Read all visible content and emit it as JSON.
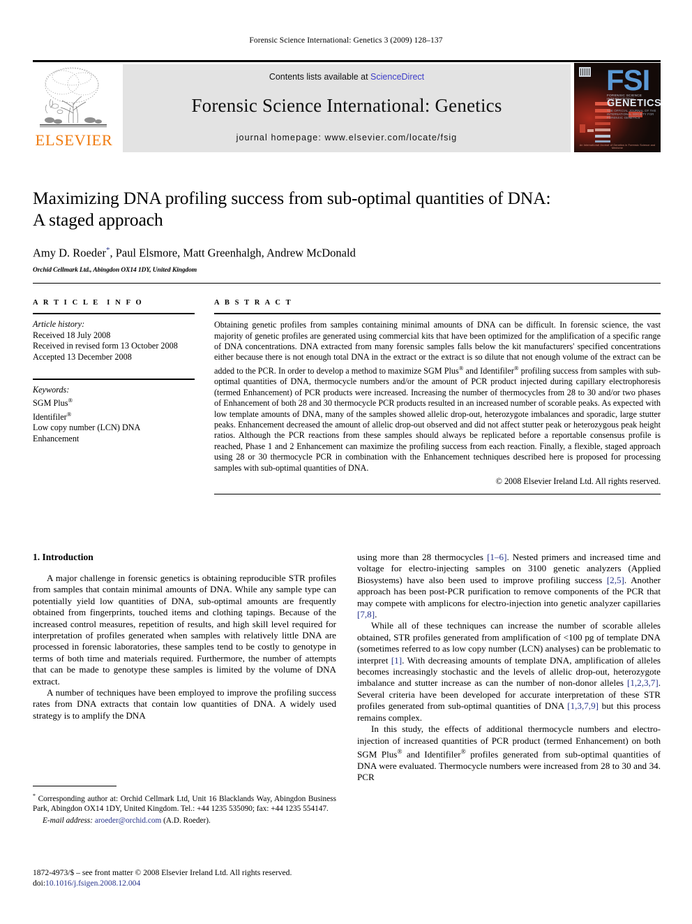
{
  "running_head": "Forensic Science International: Genetics 3 (2009) 128–137",
  "masthead": {
    "publisher_name": "ELSEVIER",
    "contents_prefix": "Contents lists available at ",
    "contents_link": "ScienceDirect",
    "journal_title": "Forensic Science International: Genetics",
    "homepage": "journal homepage: www.elsevier.com/locate/fsig",
    "cover": {
      "logo_text": "FSI",
      "logo_subtitle": "FORENSIC SCIENCE INTERNATIONAL",
      "section": "GENETICS",
      "section_subtitle": "THE OFFICIAL JOURNAL OF THE INTERNATIONAL SOCIETY FOR FORENSIC GENETICS",
      "footer": "An International Journal of Genetics in Forensic Science and Medicine"
    }
  },
  "article": {
    "title_line1": "Maximizing DNA profiling success from sub-optimal quantities of DNA:",
    "title_line2": "A staged approach",
    "authors": "Amy D. Roeder",
    "authors_rest": ", Paul Elsmore, Matt Greenhalgh, Andrew McDonald",
    "corresponding_marker": "*",
    "affiliation": "Orchid Cellmark Ltd., Abingdon OX14 1DY, United Kingdom"
  },
  "article_info": {
    "heading": "ARTICLE INFO",
    "history_label": "Article history:",
    "history": [
      "Received 18 July 2008",
      "Received in revised form 13 October 2008",
      "Accepted 13 December 2008"
    ],
    "keywords_label": "Keywords:",
    "keywords": [
      "SGM Plus®",
      "Identifiler®",
      "Low copy number (LCN) DNA",
      "Enhancement"
    ]
  },
  "abstract": {
    "heading": "ABSTRACT",
    "text": "Obtaining genetic profiles from samples containing minimal amounts of DNA can be difficult. In forensic science, the vast majority of genetic profiles are generated using commercial kits that have been optimized for the amplification of a specific range of DNA concentrations. DNA extracted from many forensic samples falls below the kit manufacturers' specified concentrations either because there is not enough total DNA in the extract or the extract is so dilute that not enough volume of the extract can be added to the PCR. In order to develop a method to maximize SGM Plus® and Identifiler® profiling success from samples with sub-optimal quantities of DNA, thermocycle numbers and/or the amount of PCR product injected during capillary electrophoresis (termed Enhancement) of PCR products were increased. Increasing the number of thermocycles from 28 to 30 and/or two phases of Enhancement of both 28 and 30 thermocycle PCR products resulted in an increased number of scorable peaks. As expected with low template amounts of DNA, many of the samples showed allelic drop-out, heterozygote imbalances and sporadic, large stutter peaks. Enhancement decreased the amount of allelic drop-out observed and did not affect stutter peak or heterozygous peak height ratios. Although the PCR reactions from these samples should always be replicated before a reportable consensus profile is reached, Phase 1 and 2 Enhancement can maximize the profiling success from each reaction. Finally, a flexible, staged approach using 28 or 30 thermocycle PCR in combination with the Enhancement techniques described here is proposed for processing samples with sub-optimal quantities of DNA.",
    "copyright": "© 2008 Elsevier Ireland Ltd. All rights reserved."
  },
  "body": {
    "section_number_title": "1. Introduction",
    "left_paragraph_1": "A major challenge in forensic genetics is obtaining reproducible STR profiles from samples that contain minimal amounts of DNA. While any sample type can potentially yield low quantities of DNA, sub-optimal amounts are frequently obtained from fingerprints, touched items and clothing tapings. Because of the increased control measures, repetition of results, and high skill level required for interpretation of profiles generated when samples with relatively little DNA are processed in forensic laboratories, these samples tend to be costly to genotype in terms of both time and materials required. Furthermore, the number of attempts that can be made to genotype these samples is limited by the volume of DNA extract.",
    "left_paragraph_2": "A number of techniques have been employed to improve the profiling success rates from DNA extracts that contain low quantities of DNA. A widely used strategy is to amplify the DNA",
    "right_paragraph_1_a": "using more than 28 thermocycles ",
    "right_ref_1": "[1–6]",
    "right_paragraph_1_b": ". Nested primers and increased time and voltage for electro-injecting samples on 3100 genetic analyzers (Applied Biosystems) have also been used to improve profiling success ",
    "right_ref_2": "[2,5]",
    "right_paragraph_1_c": ". Another approach has been post-PCR purification to remove components of the PCR that may compete with amplicons for electro-injection into genetic analyzer capillaries ",
    "right_ref_3": "[7,8]",
    "right_paragraph_1_d": ".",
    "right_paragraph_2_a": "While all of these techniques can increase the number of scorable alleles obtained, STR profiles generated from amplification of <100 pg of template DNA (sometimes referred to as low copy number (LCN) analyses) can be problematic to interpret ",
    "right_ref_4": "[1]",
    "right_paragraph_2_b": ". With decreasing amounts of template DNA, amplification of alleles becomes increasingly stochastic and the levels of allelic drop-out, heterozygote imbalance and stutter increase as can the number of non-donor alleles ",
    "right_ref_5": "[1,2,3,7]",
    "right_paragraph_2_c": ". Several criteria have been developed for accurate interpretation of these STR profiles generated from sub-optimal quantities of DNA ",
    "right_ref_6": "[1,3,7,9]",
    "right_paragraph_2_d": " but this process remains complex.",
    "right_paragraph_3": "In this study, the effects of additional thermocycle numbers and electro-injection of increased quantities of PCR product (termed Enhancement) on both SGM Plus® and Identifiler® profiles generated from sub-optimal quantities of DNA were evaluated. Thermocycle numbers were increased from 28 to 30 and 34. PCR"
  },
  "footnotes": {
    "corresponding": "Corresponding author at: Orchid Cellmark Ltd, Unit 16 Blacklands Way, Abingdon Business Park, Abingdon OX14 1DY, United Kingdom. Tel.: +44 1235 535090; fax: +44 1235 554147.",
    "email_label": "E-mail address:",
    "email": "aroeder@orchid.com",
    "email_owner": "(A.D. Roeder).",
    "issn_line": "1872-4973/$ – see front matter © 2008 Elsevier Ireland Ltd. All rights reserved.",
    "doi_label": "doi:",
    "doi_value": "10.1016/j.fsigen.2008.12.004"
  },
  "colors": {
    "elsevier_orange": "#F07C12",
    "link_blue": "#27348b",
    "sciencedirect_blue": "#3c3cc8",
    "band_gray": "#e3e3e3"
  }
}
